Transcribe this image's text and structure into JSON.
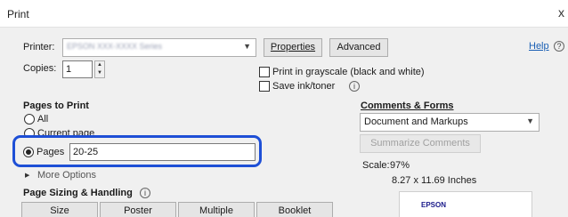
{
  "window": {
    "title": "Print",
    "close": "x"
  },
  "printer": {
    "label": "Printer:",
    "value": "EPSON XXX-XXXX Series",
    "properties_label": "Properties",
    "advanced_label": "Advanced",
    "help_label": "Help"
  },
  "copies": {
    "label": "Copies:",
    "value": "1"
  },
  "options": {
    "grayscale": "Print in grayscale (black and white)",
    "save_ink": "Save ink/toner"
  },
  "pages_to_print": {
    "title": "Pages to Print",
    "all": "All",
    "current_page": "Current page",
    "pages_label": "Pages",
    "pages_value": "20-25",
    "more_options": "More Options"
  },
  "comments_forms": {
    "title": "Comments & Forms",
    "selected": "Document and Markups",
    "summarize": "Summarize Comments"
  },
  "scale": {
    "label": "Scale:",
    "value": "97%",
    "page_size": "8.27 x 11.69 Inches"
  },
  "page_sizing": {
    "title": "Page Sizing & Handling",
    "buttons": [
      "Size",
      "Poster",
      "Multiple",
      "Booklet"
    ]
  },
  "preview": {
    "brand": "EPSON"
  }
}
